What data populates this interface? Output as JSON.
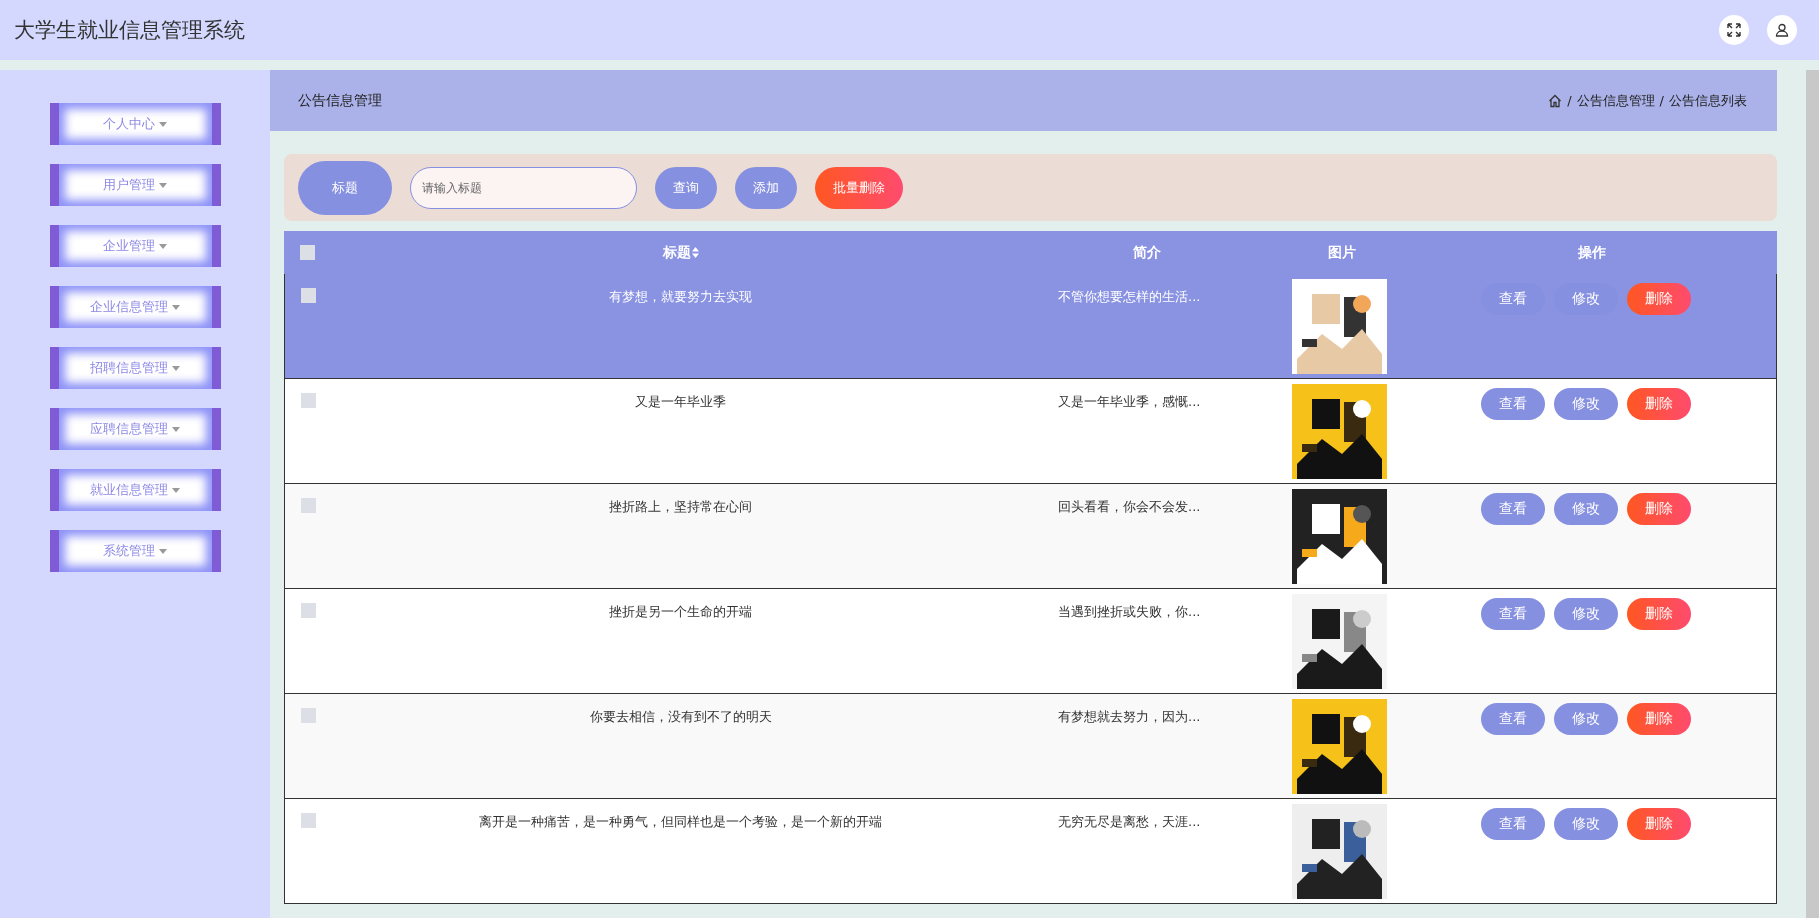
{
  "app_title": "大学生就业信息管理系统",
  "sidebar": {
    "items": [
      {
        "label": "个人中心"
      },
      {
        "label": "用户管理"
      },
      {
        "label": "企业管理"
      },
      {
        "label": "企业信息管理"
      },
      {
        "label": "招聘信息管理"
      },
      {
        "label": "应聘信息管理"
      },
      {
        "label": "就业信息管理"
      },
      {
        "label": "系统管理"
      }
    ]
  },
  "page_heading": "公告信息管理",
  "breadcrumb": [
    {
      "separator": "/",
      "label": "公告信息管理"
    },
    {
      "separator": "/",
      "label": "公告信息列表"
    }
  ],
  "search": {
    "label": "标题",
    "placeholder": "请输入标题"
  },
  "toolbar_buttons": [
    {
      "label": "查询",
      "kind": "primary"
    },
    {
      "label": "添加",
      "kind": "primary"
    },
    {
      "label": "批量删除",
      "kind": "danger"
    }
  ],
  "table": {
    "select_all_checked": false,
    "columns": [
      "标题",
      "简介",
      "图片",
      "操作"
    ],
    "rows": [
      {
        "checked": false,
        "highlighted": true,
        "title": "有梦想，就要努力去实现",
        "intro": "不管你想要怎样的生活...",
        "image": {
          "kind": "picture"
        },
        "actions": [
          {
            "label": "查看",
            "kind": "primary"
          },
          {
            "label": "修改",
            "kind": "primary"
          },
          {
            "label": "删除",
            "kind": "danger"
          }
        ]
      },
      {
        "checked": false,
        "highlighted": false,
        "title": "又是一年毕业季",
        "intro": "又是一年毕业季，感慨...",
        "image": {
          "kind": "picture"
        },
        "actions": [
          {
            "label": "查看",
            "kind": "primary"
          },
          {
            "label": "修改",
            "kind": "primary"
          },
          {
            "label": "删除",
            "kind": "danger"
          }
        ]
      },
      {
        "checked": false,
        "highlighted": false,
        "title": "挫折路上，坚持常在心间",
        "intro": "回头看看，你会不会发...",
        "image": {
          "kind": "picture"
        },
        "actions": [
          {
            "label": "查看",
            "kind": "primary"
          },
          {
            "label": "修改",
            "kind": "primary"
          },
          {
            "label": "删除",
            "kind": "danger"
          }
        ]
      },
      {
        "checked": false,
        "highlighted": false,
        "title": "挫折是另一个生命的开端",
        "intro": "当遇到挫折或失败，你...",
        "image": {
          "kind": "picture"
        },
        "actions": [
          {
            "label": "查看",
            "kind": "primary"
          },
          {
            "label": "修改",
            "kind": "primary"
          },
          {
            "label": "删除",
            "kind": "danger"
          }
        ]
      },
      {
        "checked": false,
        "highlighted": false,
        "title": "你要去相信，没有到不了的明天",
        "intro": "有梦想就去努力，因为...",
        "image": {
          "kind": "picture"
        },
        "actions": [
          {
            "label": "查看",
            "kind": "primary"
          },
          {
            "label": "修改",
            "kind": "primary"
          },
          {
            "label": "删除",
            "kind": "danger"
          }
        ]
      },
      {
        "checked": false,
        "highlighted": false,
        "title": "离开是一种痛苦，是一种勇气，但同样也是一个考验，是一个新的开端",
        "intro": "无穷无尽是离愁，天涯...",
        "image": {
          "kind": "picture"
        },
        "actions": [
          {
            "label": "查看",
            "kind": "primary"
          },
          {
            "label": "修改",
            "kind": "primary"
          },
          {
            "label": "删除",
            "kind": "danger"
          }
        ]
      }
    ]
  }
}
